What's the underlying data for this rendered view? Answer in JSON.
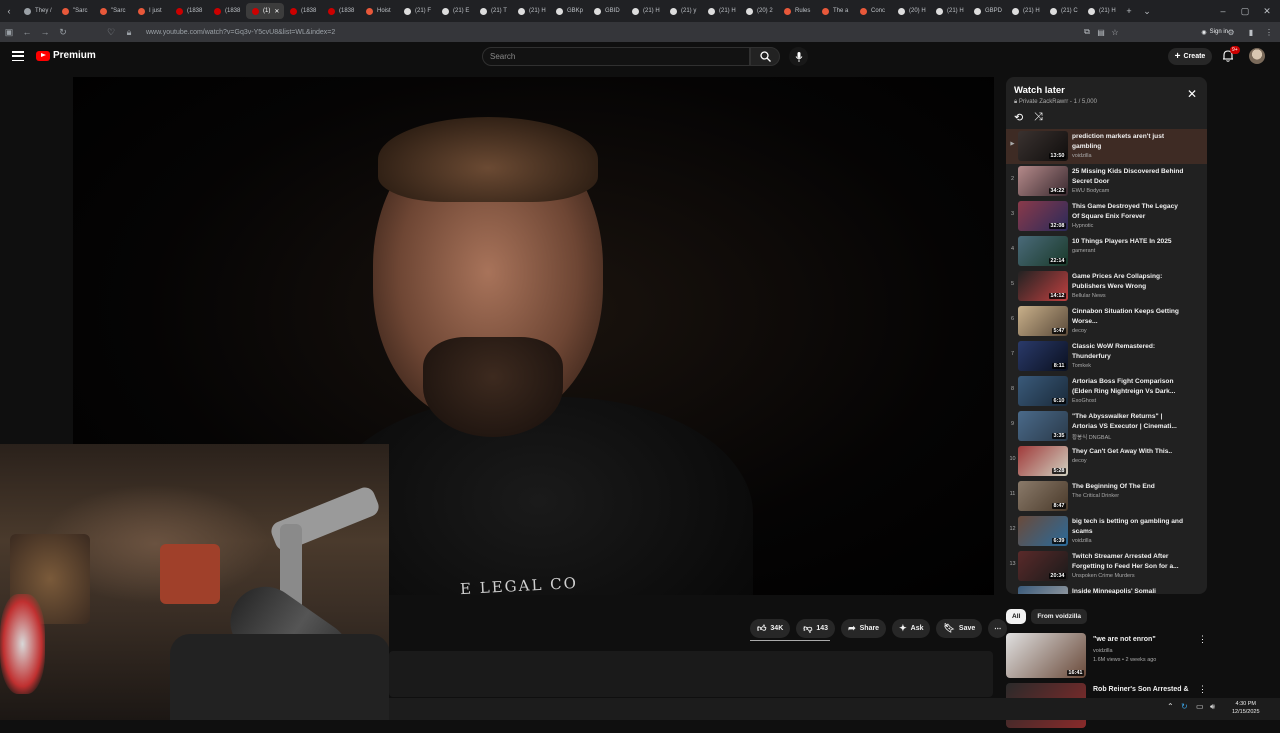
{
  "browser": {
    "tabs": [
      {
        "label": "They /",
        "color": "#9aa0a6"
      },
      {
        "label": "\"Sarc",
        "color": "#e8583a"
      },
      {
        "label": "\"Sarc",
        "color": "#e8583a"
      },
      {
        "label": "I just",
        "color": "#e8583a"
      },
      {
        "label": "(1838",
        "color": "#cc0000"
      },
      {
        "label": "(1838",
        "color": "#cc0000"
      },
      {
        "label": "(1)",
        "color": "#cc0000",
        "active": true
      },
      {
        "label": "(1838",
        "color": "#cc0000"
      },
      {
        "label": "(1838",
        "color": "#cc0000"
      },
      {
        "label": "Hoist",
        "color": "#e8583a"
      },
      {
        "label": "(21) F",
        "color": "#dddddd"
      },
      {
        "label": "(21) E",
        "color": "#dddddd"
      },
      {
        "label": "(21) T",
        "color": "#dddddd"
      },
      {
        "label": "(21) H",
        "color": "#dddddd"
      },
      {
        "label": "GBKp",
        "color": "#dddddd"
      },
      {
        "label": "GBID",
        "color": "#dddddd"
      },
      {
        "label": "(21) H",
        "color": "#dddddd"
      },
      {
        "label": "(21) y",
        "color": "#dddddd"
      },
      {
        "label": "(21) H",
        "color": "#dddddd"
      },
      {
        "label": "(20) 2",
        "color": "#dddddd"
      },
      {
        "label": "Rules",
        "color": "#e8583a"
      },
      {
        "label": "The a",
        "color": "#e8583a"
      },
      {
        "label": "Conc",
        "color": "#e8583a"
      },
      {
        "label": "(20) H",
        "color": "#dddddd"
      },
      {
        "label": "(21) H",
        "color": "#dddddd"
      },
      {
        "label": "GBPD",
        "color": "#dddddd"
      },
      {
        "label": "(21) H",
        "color": "#dddddd"
      },
      {
        "label": "(21) C",
        "color": "#dddddd"
      },
      {
        "label": "(21) H",
        "color": "#dddddd"
      }
    ],
    "new_tab": "+",
    "url": "www.youtube.com/watch?v=Gq3v-Y5cvU8&list=WL&index=2",
    "sign_in": "Sign in"
  },
  "youtube": {
    "brand": "Premium",
    "search_placeholder": "Search",
    "create_label": "Create",
    "notification_count": "9+"
  },
  "video": {
    "shirt_text": "E LEGAL CO"
  },
  "actions": {
    "likes": "34K",
    "dislikes": "143",
    "share": "Share",
    "ask": "Ask",
    "save": "Save"
  },
  "playlist": {
    "title": "Watch later",
    "privacy": "Private",
    "owner": "ZackRawrr",
    "position": "1 / 5,000",
    "items": [
      {
        "index": "▶",
        "title": "prediction markets aren't just gambling",
        "channel": "voidzilla",
        "duration": "13:50",
        "thumb": [
          "#3a3230",
          "#0f0d0c"
        ],
        "current": true
      },
      {
        "index": "2",
        "title": "25 Missing Kids Discovered Behind Secret Door",
        "channel": "EWU Bodycam",
        "duration": "34:22",
        "thumb": [
          "#b58a8a",
          "#3a2a30"
        ]
      },
      {
        "index": "3",
        "title": "This Game Destroyed The Legacy Of Square Enix Forever",
        "channel": "Hypnotic",
        "duration": "32:08",
        "thumb": [
          "#8a3a4a",
          "#2a2a5a"
        ]
      },
      {
        "index": "4",
        "title": "10 Things Players HATE In 2025",
        "channel": "gamerant",
        "duration": "22:14",
        "thumb": [
          "#4a6a7a",
          "#1a3a2a"
        ]
      },
      {
        "index": "5",
        "title": "Game Prices Are Collapsing: Publishers Were Wrong",
        "channel": "Bellular News",
        "duration": "14:12",
        "thumb": [
          "#222222",
          "#c04040"
        ]
      },
      {
        "index": "6",
        "title": "Cinnabon Situation Keeps Getting Worse...",
        "channel": "decoy",
        "duration": "5:47",
        "thumb": [
          "#c9b08a",
          "#5a4a3a"
        ]
      },
      {
        "index": "7",
        "title": "Classic WoW Remastered: Thunderfury",
        "channel": "Tomkek",
        "duration": "8:11",
        "thumb": [
          "#2a3a6a",
          "#0a1020"
        ]
      },
      {
        "index": "8",
        "title": "Artorias Boss Fight Comparison (Elden Ring Nightreign Vs Dark...",
        "channel": "ExoGhost",
        "duration": "6:10",
        "thumb": [
          "#3a5a7a",
          "#1a2a3a"
        ]
      },
      {
        "index": "9",
        "title": "\"The Abysswalker Returns\" | Artorias VS Executor | Cinemati...",
        "channel": "황봉식 DNGBAL",
        "duration": "3:35",
        "thumb": [
          "#4a6a8a",
          "#2a3a4a"
        ]
      },
      {
        "index": "10",
        "title": "They Can't Get Away With This..",
        "channel": "decoy",
        "duration": "5:28",
        "thumb": [
          "#a03a3a",
          "#d0d0c0"
        ]
      },
      {
        "index": "11",
        "title": "The Beginning Of The End",
        "channel": "The Critical Drinker",
        "duration": "8:47",
        "thumb": [
          "#8a7a6a",
          "#4a3a2a"
        ]
      },
      {
        "index": "12",
        "title": "big tech is betting on gambling and scams",
        "channel": "voidzilla",
        "duration": "6:39",
        "thumb": [
          "#6a4a3a",
          "#2a6a9a"
        ]
      },
      {
        "index": "13",
        "title": "Twitch Streamer Arrested After Forgetting to Feed Her Son for a...",
        "channel": "Unspoken Crime Murders",
        "duration": "20:34",
        "thumb": [
          "#5a2a2a",
          "#1a1a1a"
        ]
      },
      {
        "index": "14",
        "title": "Inside Minneapolis' Somali Invasion",
        "channel": "",
        "duration": "",
        "thumb": [
          "#3a5a7a",
          "#aaaaaa"
        ]
      }
    ]
  },
  "recommendations": {
    "chips": [
      "All",
      "From voidzilla"
    ],
    "items": [
      {
        "title": "\"we are not enron\"",
        "channel": "voidzilla",
        "meta": "1.6M views • 2 weeks ago",
        "duration": "16:41",
        "thumb": [
          "#e0e0e0",
          "#6a4a3a"
        ]
      },
      {
        "title": "Rob Reiner's Son Arrested &",
        "channel": "",
        "meta": "",
        "duration": "",
        "thumb": [
          "#2a2a2a",
          "#8a2a2a"
        ]
      }
    ]
  },
  "taskbar": {
    "time": "4:30 PM",
    "date": "12/15/2025"
  }
}
